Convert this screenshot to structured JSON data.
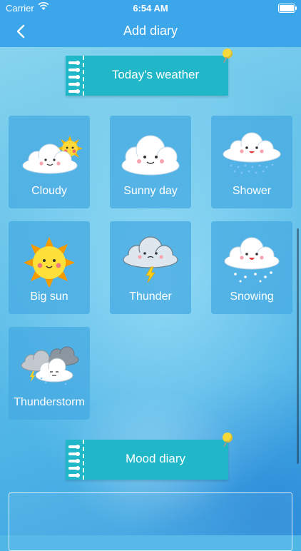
{
  "status_bar": {
    "carrier": "Carrier",
    "time": "6:54 AM"
  },
  "nav": {
    "title": "Add diary"
  },
  "weather_section": {
    "label": "Today's weather"
  },
  "weather_options": [
    {
      "label": "Cloudy",
      "icon": "cloud-with-sun-icon"
    },
    {
      "label": "Sunny day",
      "icon": "smiling-cloud-icon"
    },
    {
      "label": "Shower",
      "icon": "rain-cloud-icon"
    },
    {
      "label": "Big sun",
      "icon": "sun-icon"
    },
    {
      "label": "Thunder",
      "icon": "thunder-cloud-icon"
    },
    {
      "label": "Snowing",
      "icon": "snow-cloud-icon"
    },
    {
      "label": "Thunderstorm",
      "icon": "storm-clouds-icon"
    }
  ],
  "mood_section": {
    "label": "Mood diary"
  },
  "mood_input": {
    "value": ""
  },
  "colors": {
    "nav_bar": "#3ba6ea",
    "banner": "#20b7c8",
    "tile": "#46aae1",
    "pin": "#f5d93b"
  }
}
